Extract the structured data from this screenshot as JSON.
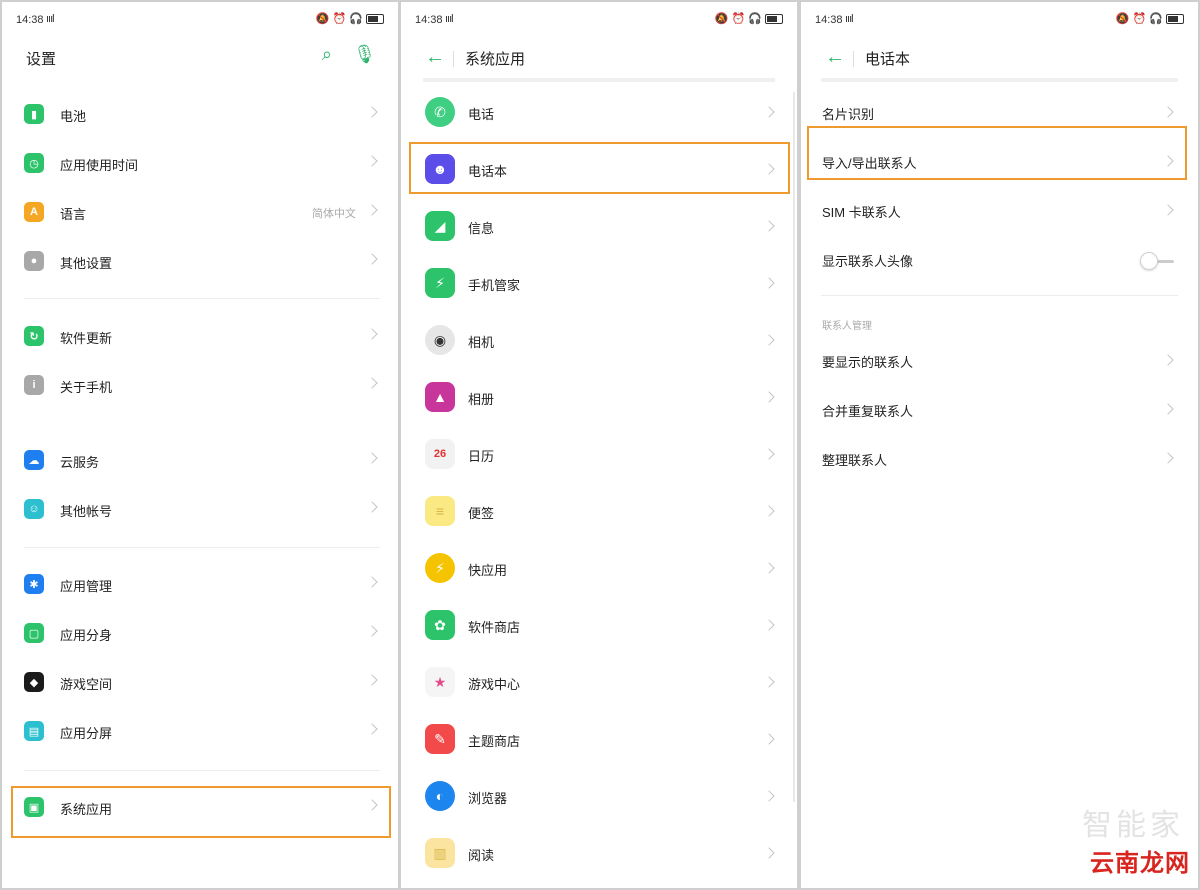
{
  "status_bar": {
    "time": "14:38",
    "signal": "ıııl"
  },
  "panel1": {
    "title": "设置",
    "items": [
      {
        "label": "电池",
        "icon": "battery-icon",
        "color": "#2cc36b"
      },
      {
        "label": "应用使用时间",
        "icon": "clock-icon",
        "color": "#2cc36b"
      },
      {
        "label": "语言",
        "icon": "language-icon",
        "color": "#f5a623",
        "value": "简体中文"
      },
      {
        "label": "其他设置",
        "icon": "settings-icon",
        "color": "#a8a8a8"
      },
      {
        "label": "软件更新",
        "icon": "update-icon",
        "color": "#2cc36b"
      },
      {
        "label": "关于手机",
        "icon": "info-icon",
        "color": "#a8a8a8"
      },
      {
        "label": "云服务",
        "icon": "cloud-icon",
        "color": "#1f7ef0"
      },
      {
        "label": "其他帐号",
        "icon": "user-icon",
        "color": "#2bbfcf"
      },
      {
        "label": "应用管理",
        "icon": "apps-icon",
        "color": "#1f7ef0"
      },
      {
        "label": "应用分身",
        "icon": "clone-icon",
        "color": "#2cc36b"
      },
      {
        "label": "游戏空间",
        "icon": "game-space-icon",
        "color": "#1b1b1b"
      },
      {
        "label": "应用分屏",
        "icon": "split-screen-icon",
        "color": "#2bbfcf"
      },
      {
        "label": "系统应用",
        "icon": "system-apps-icon",
        "color": "#2cc36b"
      }
    ]
  },
  "panel2": {
    "title": "系统应用",
    "items": [
      {
        "label": "电话",
        "icon": "phone-icon",
        "color": "#3ecf82"
      },
      {
        "label": "电话本",
        "icon": "contacts-icon",
        "color": "#5b4de8"
      },
      {
        "label": "信息",
        "icon": "messages-icon",
        "color": "#2cc36b"
      },
      {
        "label": "手机管家",
        "icon": "phone-manager-icon",
        "color": "#2cc36b"
      },
      {
        "label": "相机",
        "icon": "camera-icon",
        "color": "#e6e6e6"
      },
      {
        "label": "相册",
        "icon": "gallery-icon",
        "color": "#c8369c"
      },
      {
        "label": "日历",
        "icon": "calendar-icon",
        "color": "#f2f2f2",
        "glyph": "26"
      },
      {
        "label": "便签",
        "icon": "notes-icon",
        "color": "#fbe983"
      },
      {
        "label": "快应用",
        "icon": "quick-app-icon",
        "color": "#f5c400"
      },
      {
        "label": "软件商店",
        "icon": "app-store-icon",
        "color": "#2cc36b"
      },
      {
        "label": "游戏中心",
        "icon": "game-center-icon",
        "color": "#f5f5f5"
      },
      {
        "label": "主题商店",
        "icon": "theme-store-icon",
        "color": "#f24a4a"
      },
      {
        "label": "浏览器",
        "icon": "browser-icon",
        "color": "#1c86ee"
      },
      {
        "label": "阅读",
        "icon": "reader-icon",
        "color": "#fbe3a0"
      }
    ]
  },
  "panel3": {
    "title": "电话本",
    "items": [
      {
        "label": "名片识别"
      },
      {
        "label": "导入/导出联系人"
      },
      {
        "label": "SIM 卡联系人"
      },
      {
        "label": "显示联系人头像",
        "toggle": false
      }
    ],
    "section_title": "联系人管理",
    "section_items": [
      {
        "label": "要显示的联系人"
      },
      {
        "label": "合并重复联系人"
      },
      {
        "label": "整理联系人"
      }
    ]
  },
  "highlight_color": "#ef9a2e",
  "watermark": {
    "text1": "智能家",
    "text2": "云南龙网"
  }
}
